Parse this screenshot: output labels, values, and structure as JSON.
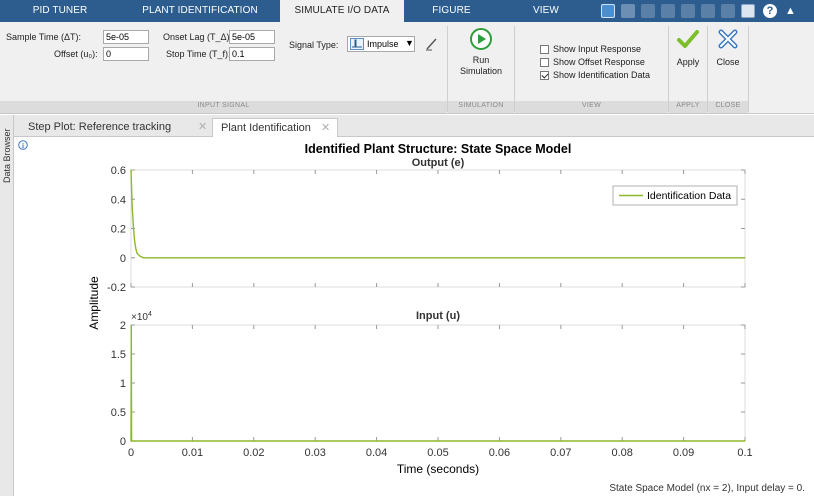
{
  "top_tabs": [
    "PID TUNER",
    "PLANT IDENTIFICATION",
    "SIMULATE I/O DATA",
    "FIGURE",
    "VIEW"
  ],
  "active_tab": "SIMULATE I/O DATA",
  "input_signal": {
    "sample_time_label": "Sample Time (ΔT):",
    "sample_time_value": "5e-05",
    "offset_label": "Offset (u₀):",
    "offset_value": "0",
    "onset_lag_label": "Onset Lag (T_Δ):",
    "onset_lag_value": "5e-05",
    "stop_time_label": "Stop Time (T_f):",
    "stop_time_value": "0.1",
    "signal_type_label": "Signal Type:",
    "signal_type_value": "Impulse",
    "section_label": "INPUT SIGNAL"
  },
  "simulation": {
    "run_label_1": "Run",
    "run_label_2": "Simulation",
    "section_label": "SIMULATION"
  },
  "view": {
    "options": [
      {
        "label": "Show Input Response",
        "checked": false
      },
      {
        "label": "Show Offset Response",
        "checked": false
      },
      {
        "label": "Show Identification Data",
        "checked": true
      }
    ],
    "section_label": "VIEW"
  },
  "apply": {
    "label": "Apply",
    "section_label": "APPLY"
  },
  "close": {
    "label": "Close",
    "section_label": "CLOSE"
  },
  "doc_tabs": [
    "Step Plot: Reference tracking",
    "Plant Identification"
  ],
  "active_doc_tab": "Plant Identification",
  "sidebar_label": "Data Browser",
  "plot": {
    "title": "Identified Plant Structure: State Space Model",
    "top_subtitle": "Output (e)",
    "bottom_subtitle": "Input (u)",
    "ylabel": "Amplitude",
    "xlabel": "Time (seconds)",
    "legend": "Identification Data",
    "exponent_label": "×10",
    "exponent_power": "4",
    "footer": "State Space Model (nx = 2), Input delay = 0."
  },
  "chart_data": [
    {
      "type": "line",
      "title": "Output (e)",
      "xlabel": "Time (seconds)",
      "ylabel": "Amplitude",
      "xlim": [
        0,
        0.1
      ],
      "ylim": [
        -0.2,
        0.6
      ],
      "x_ticks": [
        "0",
        "0.01",
        "0.02",
        "0.03",
        "0.04",
        "0.05",
        "0.06",
        "0.07",
        "0.08",
        "0.09",
        "0.1"
      ],
      "y_ticks": [
        "0.6",
        "0.4",
        "0.2",
        "0",
        "-0.2"
      ],
      "legend": "top-right",
      "series": [
        {
          "name": "Identification Data",
          "color": "#8db82b",
          "x": [
            0,
            0.0001,
            0.0002,
            0.0004,
            0.0006,
            0.0008,
            0.001,
            0.0015,
            0.002,
            0.1
          ],
          "y": [
            0.6,
            0.47,
            0.35,
            0.2,
            0.11,
            0.06,
            0.03,
            0.01,
            0.0,
            0.0
          ]
        }
      ]
    },
    {
      "type": "line",
      "title": "Input (u)",
      "xlabel": "Time (seconds)",
      "ylabel": "Amplitude",
      "xlim": [
        0,
        0.1
      ],
      "ylim": [
        0,
        20000
      ],
      "x_ticks": [
        "0",
        "0.01",
        "0.02",
        "0.03",
        "0.04",
        "0.05",
        "0.06",
        "0.07",
        "0.08",
        "0.09",
        "0.1"
      ],
      "y_ticks": [
        "2",
        "1.5",
        "1",
        "0.5",
        "0"
      ],
      "series": [
        {
          "name": "Identification Data",
          "color": "#8db82b",
          "x": [
            0,
            5e-05,
            0.0001,
            0.1
          ],
          "y": [
            0,
            20000,
            0,
            0
          ]
        }
      ]
    }
  ],
  "colors": {
    "tab_strip": "#2c5d8e",
    "ribbon": "#f0f0f0",
    "series": "#8db82b",
    "run_button": "#2e9e3a",
    "apply_check": "#7cbf2b",
    "close_x": "#3b78c4"
  },
  "icons": [
    "impulse-icon",
    "pencil-icon",
    "run-icon",
    "checkmark-icon",
    "close-x-icon",
    "info-icon"
  ]
}
